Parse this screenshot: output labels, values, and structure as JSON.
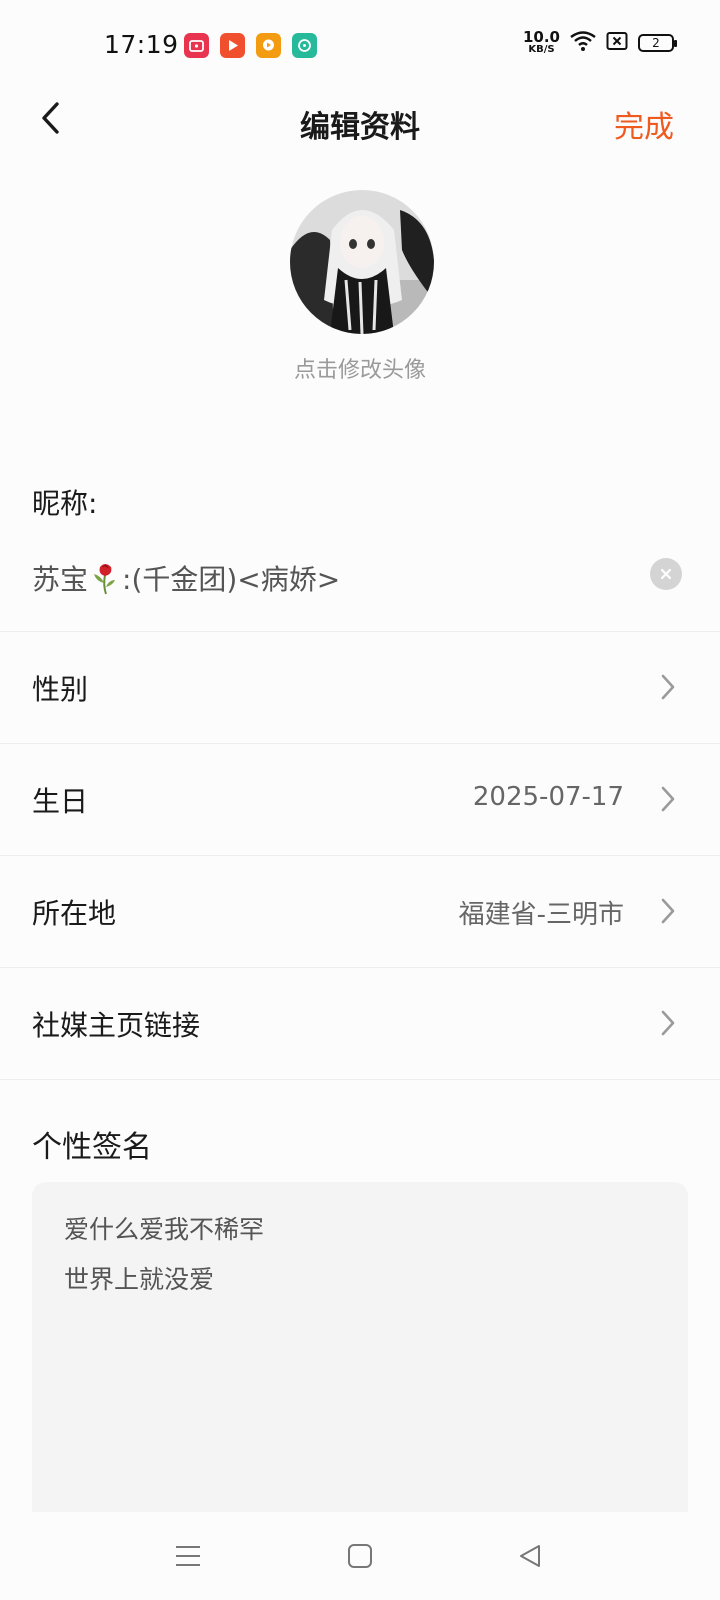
{
  "status_bar": {
    "time": "17:19",
    "net_speed_value": "10.0",
    "net_speed_unit": "KB/S",
    "battery_level": "2",
    "icons": [
      "app-icon-red-tv",
      "app-icon-red-play",
      "app-icon-orange-video",
      "app-icon-teal-chat",
      "wifi-icon",
      "sim-no-signal-icon",
      "battery-icon"
    ],
    "colors": {
      "app1": "#e8344f",
      "app2": "#f0502e",
      "app3": "#f39c12",
      "app4": "#26b99a"
    }
  },
  "header": {
    "title": "编辑资料",
    "done_label": "完成",
    "accent_color": "#ef5a1f"
  },
  "avatar": {
    "hint": "点击修改头像"
  },
  "nickname": {
    "label": "昵称:",
    "value_prefix": "苏宝",
    "value_suffix": ":(千金团)<病娇>"
  },
  "rows": [
    {
      "label": "性别",
      "value": ""
    },
    {
      "label": "生日",
      "value": "2025-07-17"
    },
    {
      "label": "所在地",
      "value": "福建省-三明市"
    },
    {
      "label": "社媒主页链接",
      "value": ""
    }
  ],
  "signature": {
    "label": "个性签名",
    "lines": [
      "爱什么爱我不稀罕",
      "世界上就没爱"
    ]
  },
  "nav_bar": {
    "icons": [
      "menu-icon",
      "home-square-icon",
      "back-triangle-icon"
    ]
  }
}
